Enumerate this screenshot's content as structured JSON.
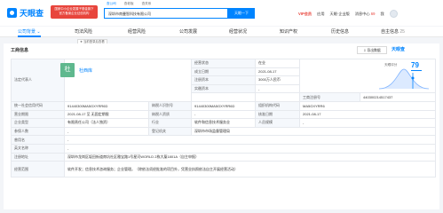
{
  "header": {
    "logo_text": "天眼查",
    "promo_line1": "国家中小企业发展子基金旗下",
    "promo_line2": "官方备案企业征信机构",
    "search_tabs": [
      "查公司",
      "查老板",
      "查关系"
    ],
    "search_value": "深圳市南曼智科技有限公司",
    "search_button": "天眼一下",
    "vip_label": "VIP会员",
    "menu_items": [
      "应用",
      "天眼·企业版",
      "消息中心"
    ],
    "message_count": "69",
    "user_label": "我"
  },
  "nav": {
    "tabs": [
      "公司背景",
      "司法风险",
      "经营风险",
      "公司发展",
      "经营状况",
      "知识产权",
      "历史信息",
      "自主信息"
    ],
    "tab_counts": [
      "",
      "",
      "",
      "",
      "",
      "",
      "",
      "25"
    ],
    "tag": "★ 当前登录后查看"
  },
  "panel": {
    "title": "工商信息",
    "export_label": "导出数据",
    "watermark": "天眼查"
  },
  "business_info": {
    "legal_rep_label": "法定代表人",
    "legal_rep_initial": "杜",
    "legal_rep_name": "杜西库",
    "status_label": "经营状态",
    "status_value": "在业",
    "established_label": "成立日期",
    "established_value": "2021-08-17",
    "registered_capital_label": "注册资本",
    "registered_capital_value": "3000万人民币",
    "paid_capital_label": "实缴资本",
    "paid_capital_value": "-",
    "score_label": "天眼评分",
    "score_value": "79",
    "reg_no_label": "工商注册号",
    "reg_no_value": "440300214517437",
    "credit_code_label": "统一社会信用代码",
    "credit_code_value": "91440300MA5GXYRR6D",
    "taxpayer_id_label": "纳税人识别号",
    "taxpayer_id_value": "91440300MA5GXYRR6D",
    "org_code_label": "组织机构代码",
    "org_code_value": "MA5GXYRR6",
    "term_label": "营业期限",
    "term_value": "2021-08-17 至 无固定期限",
    "taxpayer_qual_label": "纳税人资质",
    "taxpayer_qual_value": "-",
    "approval_date_label": "核准日期",
    "approval_date_value": "2021-08-17",
    "company_type_label": "企业类型",
    "company_type_value": "有限责任公司（法人独资）",
    "industry_label": "行业",
    "industry_value": "软件和信息技术服务业",
    "scale_label": "人员规模",
    "scale_value": "-",
    "insured_label": "参保人数",
    "insured_value": "-",
    "authority_label": "登记机关",
    "authority_value": "深圳市市场监督管理局",
    "former_name_label": "曾用名",
    "former_name_value": "-",
    "english_name_label": "英文名称",
    "english_name_value": "-",
    "address_label": "注册地址",
    "address_value": "深圳市龙岗区坂田街道南坑社区雅宝路1号星河WORLD 2栋大厦1801A（自主申报）",
    "scope_label": "经营范围",
    "scope_value": "软件开发；信息技术咨询服务；企业管理。（除依法须经批准的项目外，凭营业执照依法自主开展经营活动）"
  },
  "colors": {
    "accent": "#0084ff",
    "promo": "#e8453c",
    "legal_avatar": "#5fb88e"
  }
}
